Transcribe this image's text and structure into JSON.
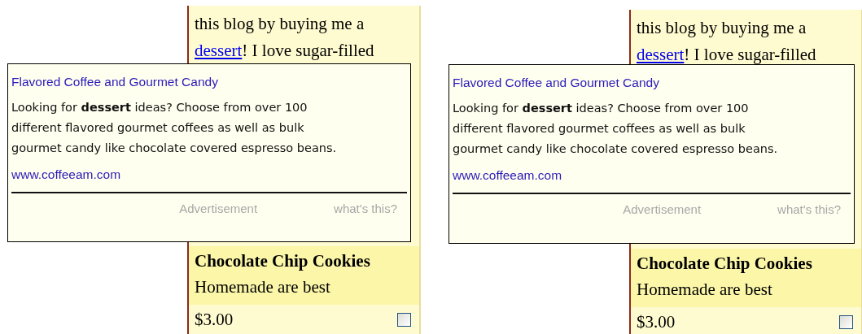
{
  "panels": [
    {
      "post": {
        "before": "this blog by buying me a",
        "link": "dessert",
        "after": "! I love sugar-filled",
        "link_hovered": false
      },
      "ad": {
        "title": "Flavored Coffee and Gourmet Candy",
        "body": "Looking for **dessert** ideas? Choose from over 100 different flavored gourmet coffees as well as bulk gourmet candy like chocolate covered espresso beans.",
        "url": "www.coffeeam.com",
        "label": "Advertisement",
        "help": "what's this?"
      },
      "item": {
        "title": "Chocolate Chip Cookies",
        "description": "Homemade are best",
        "price": "$3.00",
        "checked": false
      }
    },
    {
      "post": {
        "before": "this blog by buying me a",
        "link": "dessert",
        "after": "! I love sugar-filled",
        "link_hovered": true
      },
      "ad": {
        "title": "Flavored Coffee and Gourmet Candy",
        "body": "Looking for **dessert** ideas? Choose from over 100 different flavored gourmet coffees as well as bulk gourmet candy like chocolate covered espresso beans.",
        "url": "www.coffeeam.com",
        "label": "Advertisement",
        "help": "what's this?"
      },
      "item": {
        "title": "Chocolate Chip Cookies",
        "description": "Homemade are best",
        "price": "$3.00",
        "checked": false
      }
    }
  ]
}
